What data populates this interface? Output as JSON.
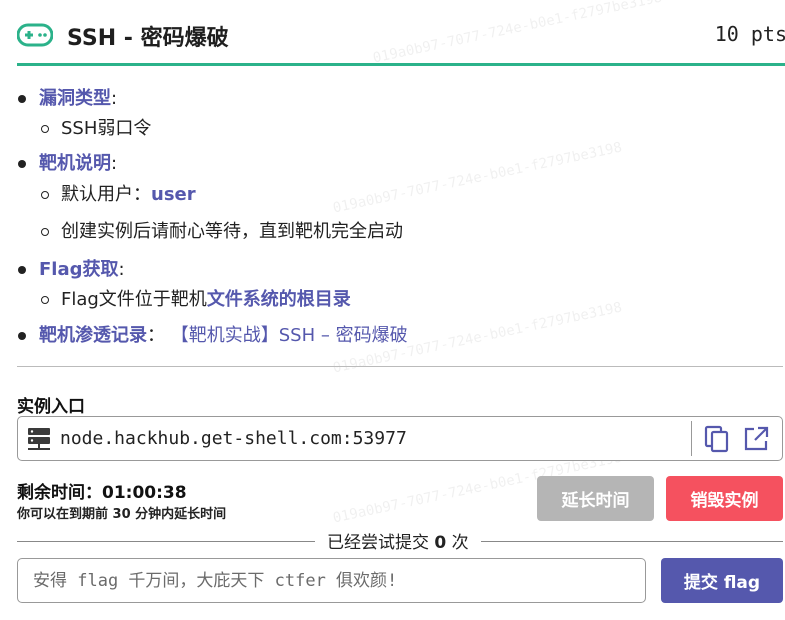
{
  "header": {
    "icon": "gamepad-icon",
    "title": "SSH - 密码爆破",
    "points": "10 pts"
  },
  "description": {
    "vuln_type": {
      "label": "漏洞类型",
      "value": "SSH弱口令"
    },
    "target_info": {
      "label": "靶机说明",
      "default_user_label": "默认用户：",
      "default_user": "user",
      "wait_hint": "创建实例后请耐心等待，直到靶机完全启动"
    },
    "flag_get": {
      "label": "Flag获取",
      "location_prefix": "Flag文件位于靶机",
      "location_highlight": "文件系统的根目录"
    },
    "writeup": {
      "label": "靶机渗透记录",
      "link_text": "【靶机实战】SSH – 密码爆破"
    },
    "colon": ":",
    "colon_full": "："
  },
  "instance": {
    "entry_label": "实例入口",
    "address": "node.hackhub.get-shell.com:53977",
    "timer_label": "剩余时间：",
    "timer_value": "01:00:38",
    "extend_hint": "你可以在到期前 30 分钟内延长时间",
    "extend_button": "延长时间",
    "destroy_button": "销毁实例"
  },
  "submit": {
    "attempts_text": "已经尝试提交",
    "attempts_count": "0",
    "attempts_unit": "次",
    "placeholder": "安得 flag 千万间，大庇天下 ctfer 俱欢颜!",
    "submit_button": "提交 flag"
  },
  "colors": {
    "accent": "#5558ad",
    "header_underline": "#2bb28a",
    "danger": "#f5515f",
    "disabled": "#b5b5b5"
  },
  "watermark": "019a0b97-7077-724e-b0e1-f2797be3198"
}
